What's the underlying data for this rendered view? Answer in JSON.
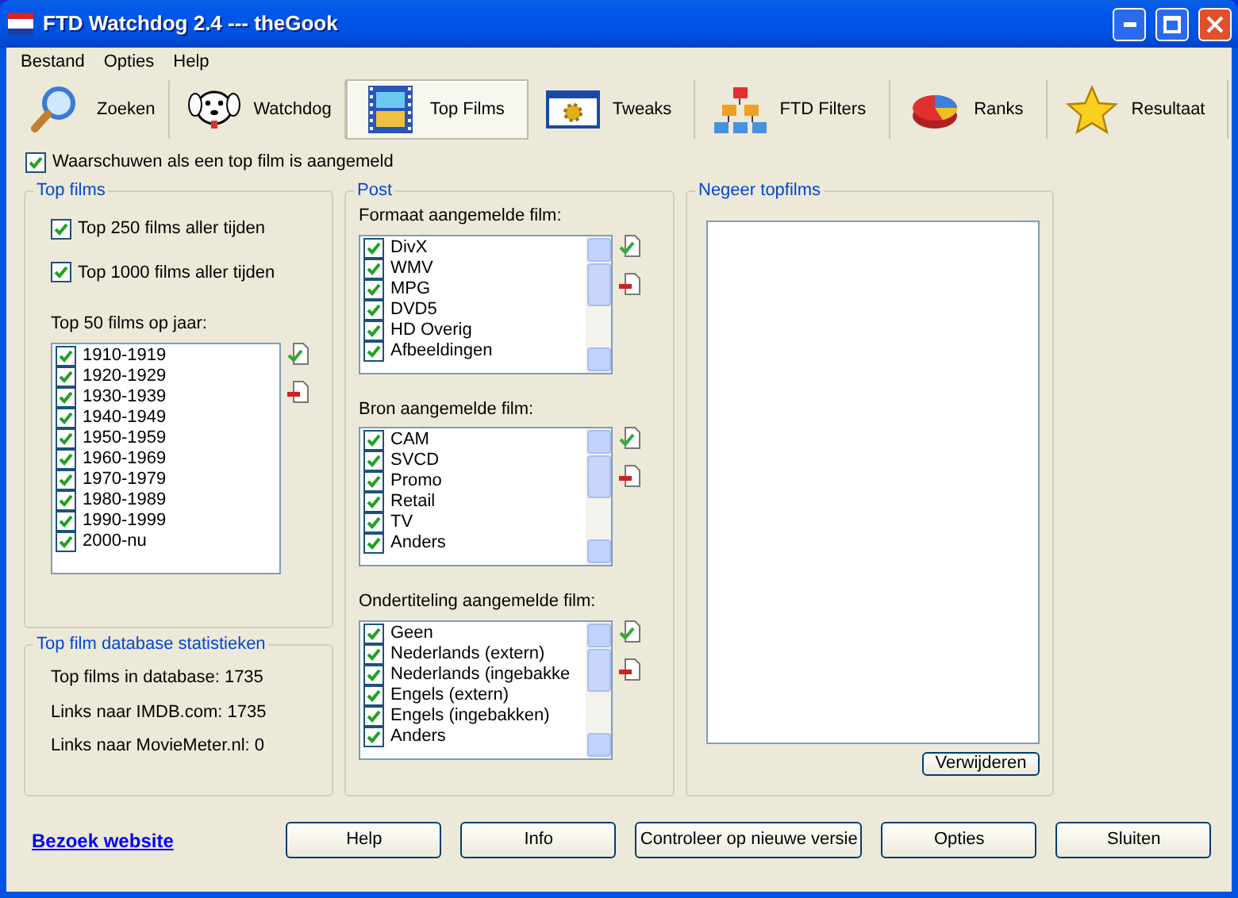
{
  "window": {
    "title": "FTD Watchdog 2.4 --- theGook"
  },
  "menu": [
    "Bestand",
    "Opties",
    "Help"
  ],
  "tabs": [
    {
      "label": "Zoeken",
      "selected": false
    },
    {
      "label": "Watchdog",
      "selected": false
    },
    {
      "label": "Top Films",
      "selected": true
    },
    {
      "label": "Tweaks",
      "selected": false
    },
    {
      "label": "FTD Filters",
      "selected": false
    },
    {
      "label": "Ranks",
      "selected": false
    },
    {
      "label": "Resultaat",
      "selected": false
    }
  ],
  "warn_checkbox": {
    "label": "Waarschuwen als een top film is aangemeld",
    "checked": true
  },
  "top_films": {
    "title": "Top films",
    "options": [
      {
        "label": "Top 250 films aller tijden",
        "checked": true
      },
      {
        "label": "Top 1000 films aller tijden",
        "checked": true
      }
    ],
    "years_label": "Top 50 films op jaar:",
    "years": [
      {
        "label": "1910-1919",
        "checked": true
      },
      {
        "label": "1920-1929",
        "checked": true
      },
      {
        "label": "1930-1939",
        "checked": true
      },
      {
        "label": "1940-1949",
        "checked": true
      },
      {
        "label": "1950-1959",
        "checked": true
      },
      {
        "label": "1960-1969",
        "checked": true
      },
      {
        "label": "1970-1979",
        "checked": true
      },
      {
        "label": "1980-1989",
        "checked": true
      },
      {
        "label": "1990-1999",
        "checked": true
      },
      {
        "label": "2000-nu",
        "checked": true
      }
    ]
  },
  "stats": {
    "title": "Top film database statistieken",
    "lines": [
      "Top films in database: 1735",
      "Links naar IMDB.com: 1735",
      "Links naar MovieMeter.nl: 0"
    ]
  },
  "post": {
    "title": "Post",
    "lists": [
      {
        "label": "Formaat aangemelde film:",
        "items": [
          {
            "label": "DivX",
            "checked": true
          },
          {
            "label": "WMV",
            "checked": true
          },
          {
            "label": "MPG",
            "checked": true
          },
          {
            "label": "DVD5",
            "checked": true
          },
          {
            "label": "HD Overig",
            "checked": true
          },
          {
            "label": "Afbeeldingen",
            "checked": true
          }
        ]
      },
      {
        "label": "Bron aangemelde film:",
        "items": [
          {
            "label": "CAM",
            "checked": true
          },
          {
            "label": "SVCD",
            "checked": true
          },
          {
            "label": "Promo",
            "checked": true
          },
          {
            "label": "Retail",
            "checked": true
          },
          {
            "label": "TV",
            "checked": true
          },
          {
            "label": "Anders",
            "checked": true
          }
        ]
      },
      {
        "label": "Ondertiteling aangemelde film:",
        "items": [
          {
            "label": "Geen",
            "checked": true
          },
          {
            "label": "Nederlands (extern)",
            "checked": true
          },
          {
            "label": "Nederlands (ingebakke",
            "checked": true
          },
          {
            "label": "Engels (extern)",
            "checked": true
          },
          {
            "label": "Engels (ingebakken)",
            "checked": true
          },
          {
            "label": "Anders",
            "checked": true
          }
        ]
      }
    ]
  },
  "ignore": {
    "title": "Negeer topfilms",
    "button": "Verwijderen"
  },
  "link": "Bezoek website",
  "buttons": [
    "Help",
    "Info",
    "Controleer op nieuwe versie",
    "Opties",
    "Sluiten"
  ]
}
